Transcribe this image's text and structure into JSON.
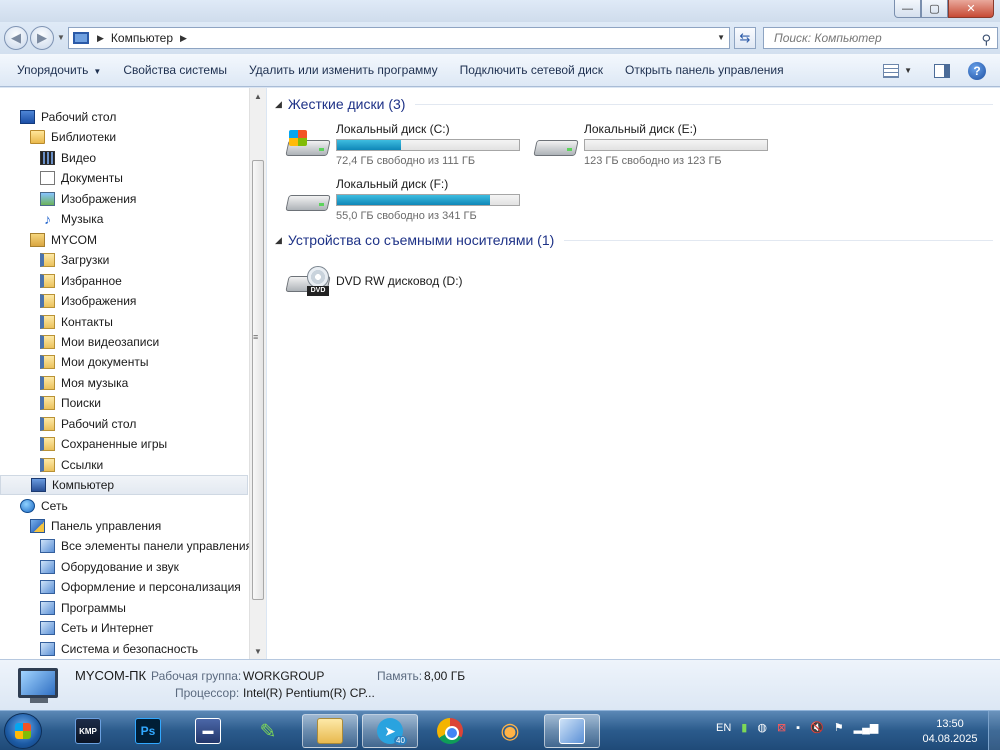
{
  "window": {
    "minimize_icon": "—",
    "maximize_icon": "▢",
    "close_icon": "✕"
  },
  "address_bar": {
    "segments": [
      "Компьютер"
    ],
    "search_placeholder": "Поиск: Компьютер"
  },
  "toolbar": {
    "organize": "Упорядочить",
    "system_properties": "Свойства системы",
    "uninstall": "Удалить или изменить программу",
    "map_drive": "Подключить сетевой диск",
    "control_panel": "Открыть панель управления",
    "help_icon": "?"
  },
  "nav": {
    "items": [
      {
        "label": "Рабочий стол",
        "icon": "desktop-icon"
      },
      {
        "label": "Библиотеки",
        "icon": "libraries-icon"
      },
      {
        "label": "Видео",
        "icon": "video-icon"
      },
      {
        "label": "Документы",
        "icon": "documents-icon"
      },
      {
        "label": "Изображения",
        "icon": "pictures-icon"
      },
      {
        "label": "Музыка",
        "icon": "music-icon"
      },
      {
        "label": "MYCOM",
        "icon": "user-folder-icon"
      },
      {
        "label": "Загрузки",
        "icon": "folder-icon"
      },
      {
        "label": "Избранное",
        "icon": "folder-icon"
      },
      {
        "label": "Изображения",
        "icon": "folder-icon"
      },
      {
        "label": "Контакты",
        "icon": "folder-icon"
      },
      {
        "label": "Мои видеозаписи",
        "icon": "folder-icon"
      },
      {
        "label": "Мои документы",
        "icon": "folder-icon"
      },
      {
        "label": "Моя музыка",
        "icon": "folder-icon"
      },
      {
        "label": "Поиски",
        "icon": "folder-icon"
      },
      {
        "label": "Рабочий стол",
        "icon": "folder-icon"
      },
      {
        "label": "Сохраненные игры",
        "icon": "folder-icon"
      },
      {
        "label": "Ссылки",
        "icon": "folder-icon"
      },
      {
        "label": "Компьютер",
        "icon": "computer-icon"
      },
      {
        "label": "Сеть",
        "icon": "network-icon"
      },
      {
        "label": "Панель управления",
        "icon": "control-panel-icon"
      },
      {
        "label": "Все элементы панели управления",
        "icon": "control-panel-item-icon"
      },
      {
        "label": "Оборудование и звук",
        "icon": "control-panel-item-icon"
      },
      {
        "label": "Оформление и персонализация",
        "icon": "control-panel-item-icon"
      },
      {
        "label": "Программы",
        "icon": "control-panel-item-icon"
      },
      {
        "label": "Сеть и Интернет",
        "icon": "control-panel-item-icon"
      },
      {
        "label": "Система и безопасность",
        "icon": "control-panel-item-icon"
      }
    ],
    "selected_index": 18
  },
  "content": {
    "hard_disks_header": "Жесткие диски (3)",
    "removable_header": "Устройства со съемными носителями (1)",
    "drives": [
      {
        "name": "Локальный диск (C:)",
        "free": "72,4 ГБ свободно из 111 ГБ",
        "used_fraction": 0.35
      },
      {
        "name": "Локальный диск (E:)",
        "free": "123 ГБ свободно из 123 ГБ",
        "used_fraction": 0.0
      },
      {
        "name": "Локальный диск (F:)",
        "free": "55,0 ГБ свободно из 341 ГБ",
        "used_fraction": 0.84
      }
    ],
    "dvd": {
      "name": "DVD RW дисковод (D:)",
      "badge": "DVD"
    }
  },
  "details": {
    "computer_name": "MYCOM-ПК",
    "workgroup_label": "Рабочая группа:",
    "workgroup_value": "WORKGROUP",
    "memory_label": "Память:",
    "memory_value": "8,00 ГБ",
    "cpu_label": "Процессор:",
    "cpu_value": "Intel(R) Pentium(R) CP..."
  },
  "taskbar": {
    "apps": [
      {
        "name": "kmplayer",
        "glyph": "KMP"
      },
      {
        "name": "photoshop",
        "glyph": "Ps"
      },
      {
        "name": "save",
        "glyph": "▬"
      },
      {
        "name": "pen-tool",
        "glyph": "✎"
      },
      {
        "name": "explorer",
        "glyph": ""
      },
      {
        "name": "telegram",
        "glyph": "➤",
        "badge": "40"
      },
      {
        "name": "chrome",
        "glyph": ""
      },
      {
        "name": "eye-app",
        "glyph": "◉"
      },
      {
        "name": "control-panel",
        "glyph": ""
      }
    ],
    "language": "EN",
    "time": "13:50",
    "date": "04.08.2025"
  }
}
